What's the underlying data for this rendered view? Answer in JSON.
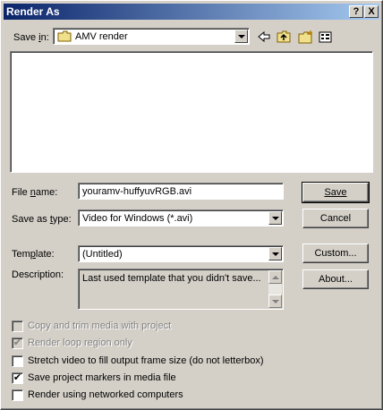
{
  "window": {
    "title": "Render As",
    "help_btn": "?",
    "close_btn": "X"
  },
  "save_in": {
    "label_pre": "Save ",
    "label_u": "i",
    "label_post": "n:",
    "value": "AMV render"
  },
  "toolbar": {
    "back_icon": "back-arrow-icon",
    "up_icon": "up-folder-icon",
    "new_folder_icon": "new-folder-icon",
    "views_icon": "views-menu-icon"
  },
  "file_name": {
    "label_pre": "File ",
    "label_u": "n",
    "label_post": "ame:",
    "value": "youramv-huffyuvRGB.avi"
  },
  "save_as_type": {
    "label_pre": "Save as ",
    "label_u": "t",
    "label_post": "ype:",
    "value": "Video for Windows (*.avi)"
  },
  "template": {
    "label_pre": "Tem",
    "label_u": "p",
    "label_post": "late:",
    "value": "(Untitled)"
  },
  "description": {
    "label": "Description:",
    "value": "Last used template that you didn't save..."
  },
  "buttons": {
    "save": "Save",
    "cancel": "Cancel",
    "custom": "Custom...",
    "about": "About..."
  },
  "options": [
    {
      "label": "Copy and trim media with project",
      "checked": false,
      "disabled": true
    },
    {
      "label": "Render loop region only",
      "checked": true,
      "disabled": true
    },
    {
      "label": "Stretch video to fill output frame size (do not letterbox)",
      "checked": false,
      "disabled": false
    },
    {
      "label": "Save project markers in media file",
      "checked": true,
      "disabled": false
    },
    {
      "label": "Render using networked computers",
      "checked": false,
      "disabled": false
    }
  ],
  "colors": {
    "title_start": "#0a246a",
    "title_end": "#a6caf0",
    "face": "#d4d0c8"
  }
}
